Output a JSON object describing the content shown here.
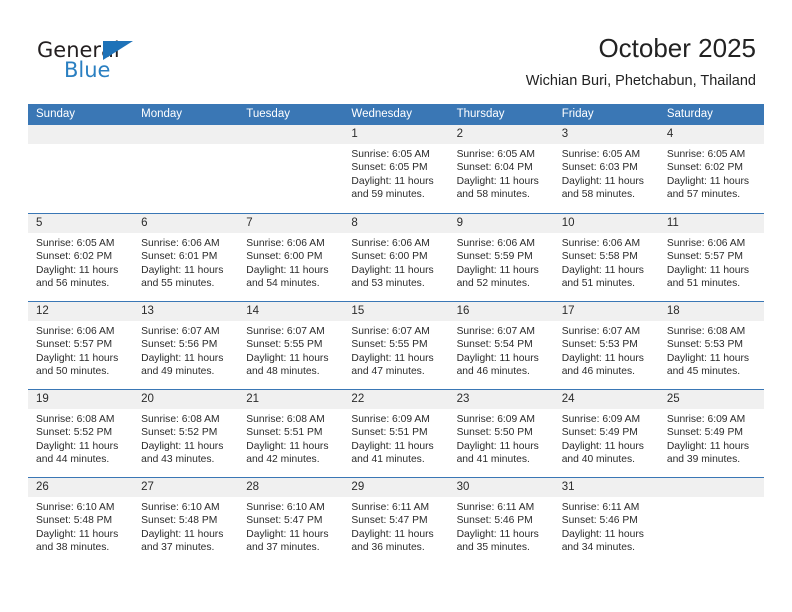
{
  "brand": {
    "name_top": "General",
    "name_bottom": "Blue",
    "triangle_color": "#1e72b8",
    "blue_color": "#2a7fc1"
  },
  "header": {
    "title": "October 2025",
    "subtitle": "Wichian Buri, Phetchabun, Thailand",
    "accent_color": "#3a77b5",
    "band_color": "#f0f0f0"
  },
  "calendar": {
    "day_names": [
      "Sunday",
      "Monday",
      "Tuesday",
      "Wednesday",
      "Thursday",
      "Friday",
      "Saturday"
    ],
    "weeks": [
      [
        {
          "day": "",
          "sunrise": "",
          "sunset": "",
          "daylight_line1": "",
          "daylight_line2": ""
        },
        {
          "day": "",
          "sunrise": "",
          "sunset": "",
          "daylight_line1": "",
          "daylight_line2": ""
        },
        {
          "day": "",
          "sunrise": "",
          "sunset": "",
          "daylight_line1": "",
          "daylight_line2": ""
        },
        {
          "day": "1",
          "sunrise": "Sunrise: 6:05 AM",
          "sunset": "Sunset: 6:05 PM",
          "daylight_line1": "Daylight: 11 hours",
          "daylight_line2": "and 59 minutes."
        },
        {
          "day": "2",
          "sunrise": "Sunrise: 6:05 AM",
          "sunset": "Sunset: 6:04 PM",
          "daylight_line1": "Daylight: 11 hours",
          "daylight_line2": "and 58 minutes."
        },
        {
          "day": "3",
          "sunrise": "Sunrise: 6:05 AM",
          "sunset": "Sunset: 6:03 PM",
          "daylight_line1": "Daylight: 11 hours",
          "daylight_line2": "and 58 minutes."
        },
        {
          "day": "4",
          "sunrise": "Sunrise: 6:05 AM",
          "sunset": "Sunset: 6:02 PM",
          "daylight_line1": "Daylight: 11 hours",
          "daylight_line2": "and 57 minutes."
        }
      ],
      [
        {
          "day": "5",
          "sunrise": "Sunrise: 6:05 AM",
          "sunset": "Sunset: 6:02 PM",
          "daylight_line1": "Daylight: 11 hours",
          "daylight_line2": "and 56 minutes."
        },
        {
          "day": "6",
          "sunrise": "Sunrise: 6:06 AM",
          "sunset": "Sunset: 6:01 PM",
          "daylight_line1": "Daylight: 11 hours",
          "daylight_line2": "and 55 minutes."
        },
        {
          "day": "7",
          "sunrise": "Sunrise: 6:06 AM",
          "sunset": "Sunset: 6:00 PM",
          "daylight_line1": "Daylight: 11 hours",
          "daylight_line2": "and 54 minutes."
        },
        {
          "day": "8",
          "sunrise": "Sunrise: 6:06 AM",
          "sunset": "Sunset: 6:00 PM",
          "daylight_line1": "Daylight: 11 hours",
          "daylight_line2": "and 53 minutes."
        },
        {
          "day": "9",
          "sunrise": "Sunrise: 6:06 AM",
          "sunset": "Sunset: 5:59 PM",
          "daylight_line1": "Daylight: 11 hours",
          "daylight_line2": "and 52 minutes."
        },
        {
          "day": "10",
          "sunrise": "Sunrise: 6:06 AM",
          "sunset": "Sunset: 5:58 PM",
          "daylight_line1": "Daylight: 11 hours",
          "daylight_line2": "and 51 minutes."
        },
        {
          "day": "11",
          "sunrise": "Sunrise: 6:06 AM",
          "sunset": "Sunset: 5:57 PM",
          "daylight_line1": "Daylight: 11 hours",
          "daylight_line2": "and 51 minutes."
        }
      ],
      [
        {
          "day": "12",
          "sunrise": "Sunrise: 6:06 AM",
          "sunset": "Sunset: 5:57 PM",
          "daylight_line1": "Daylight: 11 hours",
          "daylight_line2": "and 50 minutes."
        },
        {
          "day": "13",
          "sunrise": "Sunrise: 6:07 AM",
          "sunset": "Sunset: 5:56 PM",
          "daylight_line1": "Daylight: 11 hours",
          "daylight_line2": "and 49 minutes."
        },
        {
          "day": "14",
          "sunrise": "Sunrise: 6:07 AM",
          "sunset": "Sunset: 5:55 PM",
          "daylight_line1": "Daylight: 11 hours",
          "daylight_line2": "and 48 minutes."
        },
        {
          "day": "15",
          "sunrise": "Sunrise: 6:07 AM",
          "sunset": "Sunset: 5:55 PM",
          "daylight_line1": "Daylight: 11 hours",
          "daylight_line2": "and 47 minutes."
        },
        {
          "day": "16",
          "sunrise": "Sunrise: 6:07 AM",
          "sunset": "Sunset: 5:54 PM",
          "daylight_line1": "Daylight: 11 hours",
          "daylight_line2": "and 46 minutes."
        },
        {
          "day": "17",
          "sunrise": "Sunrise: 6:07 AM",
          "sunset": "Sunset: 5:53 PM",
          "daylight_line1": "Daylight: 11 hours",
          "daylight_line2": "and 46 minutes."
        },
        {
          "day": "18",
          "sunrise": "Sunrise: 6:08 AM",
          "sunset": "Sunset: 5:53 PM",
          "daylight_line1": "Daylight: 11 hours",
          "daylight_line2": "and 45 minutes."
        }
      ],
      [
        {
          "day": "19",
          "sunrise": "Sunrise: 6:08 AM",
          "sunset": "Sunset: 5:52 PM",
          "daylight_line1": "Daylight: 11 hours",
          "daylight_line2": "and 44 minutes."
        },
        {
          "day": "20",
          "sunrise": "Sunrise: 6:08 AM",
          "sunset": "Sunset: 5:52 PM",
          "daylight_line1": "Daylight: 11 hours",
          "daylight_line2": "and 43 minutes."
        },
        {
          "day": "21",
          "sunrise": "Sunrise: 6:08 AM",
          "sunset": "Sunset: 5:51 PM",
          "daylight_line1": "Daylight: 11 hours",
          "daylight_line2": "and 42 minutes."
        },
        {
          "day": "22",
          "sunrise": "Sunrise: 6:09 AM",
          "sunset": "Sunset: 5:51 PM",
          "daylight_line1": "Daylight: 11 hours",
          "daylight_line2": "and 41 minutes."
        },
        {
          "day": "23",
          "sunrise": "Sunrise: 6:09 AM",
          "sunset": "Sunset: 5:50 PM",
          "daylight_line1": "Daylight: 11 hours",
          "daylight_line2": "and 41 minutes."
        },
        {
          "day": "24",
          "sunrise": "Sunrise: 6:09 AM",
          "sunset": "Sunset: 5:49 PM",
          "daylight_line1": "Daylight: 11 hours",
          "daylight_line2": "and 40 minutes."
        },
        {
          "day": "25",
          "sunrise": "Sunrise: 6:09 AM",
          "sunset": "Sunset: 5:49 PM",
          "daylight_line1": "Daylight: 11 hours",
          "daylight_line2": "and 39 minutes."
        }
      ],
      [
        {
          "day": "26",
          "sunrise": "Sunrise: 6:10 AM",
          "sunset": "Sunset: 5:48 PM",
          "daylight_line1": "Daylight: 11 hours",
          "daylight_line2": "and 38 minutes."
        },
        {
          "day": "27",
          "sunrise": "Sunrise: 6:10 AM",
          "sunset": "Sunset: 5:48 PM",
          "daylight_line1": "Daylight: 11 hours",
          "daylight_line2": "and 37 minutes."
        },
        {
          "day": "28",
          "sunrise": "Sunrise: 6:10 AM",
          "sunset": "Sunset: 5:47 PM",
          "daylight_line1": "Daylight: 11 hours",
          "daylight_line2": "and 37 minutes."
        },
        {
          "day": "29",
          "sunrise": "Sunrise: 6:11 AM",
          "sunset": "Sunset: 5:47 PM",
          "daylight_line1": "Daylight: 11 hours",
          "daylight_line2": "and 36 minutes."
        },
        {
          "day": "30",
          "sunrise": "Sunrise: 6:11 AM",
          "sunset": "Sunset: 5:46 PM",
          "daylight_line1": "Daylight: 11 hours",
          "daylight_line2": "and 35 minutes."
        },
        {
          "day": "31",
          "sunrise": "Sunrise: 6:11 AM",
          "sunset": "Sunset: 5:46 PM",
          "daylight_line1": "Daylight: 11 hours",
          "daylight_line2": "and 34 minutes."
        },
        {
          "day": "",
          "sunrise": "",
          "sunset": "",
          "daylight_line1": "",
          "daylight_line2": ""
        }
      ]
    ]
  }
}
